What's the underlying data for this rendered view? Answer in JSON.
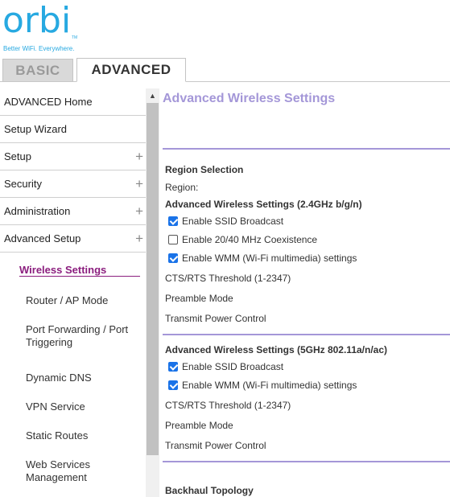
{
  "brand": {
    "logo_text": "orbi",
    "trademark": "TM",
    "tagline": "Better WiFi. Everywhere."
  },
  "tabs": {
    "basic": "BASIC",
    "advanced": "ADVANCED"
  },
  "sidebar": {
    "items": [
      {
        "label": "ADVANCED Home",
        "expandable": false
      },
      {
        "label": "Setup Wizard",
        "expandable": false
      },
      {
        "label": "Setup",
        "expandable": true
      },
      {
        "label": "Security",
        "expandable": true
      },
      {
        "label": "Administration",
        "expandable": true
      },
      {
        "label": "Advanced Setup",
        "expandable": true
      }
    ],
    "plus_glyph": "+",
    "subitems": {
      "active": "Wireless Settings",
      "router_ap": "Router / AP Mode",
      "port_forwarding_1": "Port Forwarding / Port",
      "port_forwarding_2": "Triggering",
      "dynamic_dns": "Dynamic DNS",
      "vpn": "VPN Service",
      "static_routes": "Static Routes",
      "web_services_1": "Web Services",
      "web_services_2": "Management"
    }
  },
  "main": {
    "title": "Advanced Wireless Settings",
    "region": {
      "heading": "Region Selection",
      "label": "Region:"
    },
    "band24": {
      "heading": "Advanced Wireless Settings (2.4GHz b/g/n)",
      "ssid_broadcast": {
        "label": "Enable SSID Broadcast",
        "checked": true
      },
      "coexistence": {
        "label": "Enable 20/40 MHz Coexistence",
        "checked": false
      },
      "wmm": {
        "label": "Enable WMM (Wi-Fi multimedia) settings",
        "checked": true
      },
      "cts_rts": "CTS/RTS Threshold (1-2347)",
      "preamble": "Preamble Mode",
      "tx_power": "Transmit Power Control"
    },
    "band5": {
      "heading": "Advanced Wireless Settings (5GHz 802.11a/n/ac)",
      "ssid_broadcast": {
        "label": "Enable SSID Broadcast",
        "checked": true
      },
      "wmm": {
        "label": "Enable WMM (Wi-Fi multimedia) settings",
        "checked": true
      },
      "cts_rts": "CTS/RTS Threshold (1-2347)",
      "preamble": "Preamble Mode",
      "tx_power": "Transmit Power Control"
    },
    "backhaul": {
      "heading": "Backhaul Topology"
    }
  },
  "colors": {
    "brand": "#27a9e1",
    "accent": "#a497d8",
    "active_nav": "#8b1e7e",
    "checkbox": "#1a73e8"
  }
}
